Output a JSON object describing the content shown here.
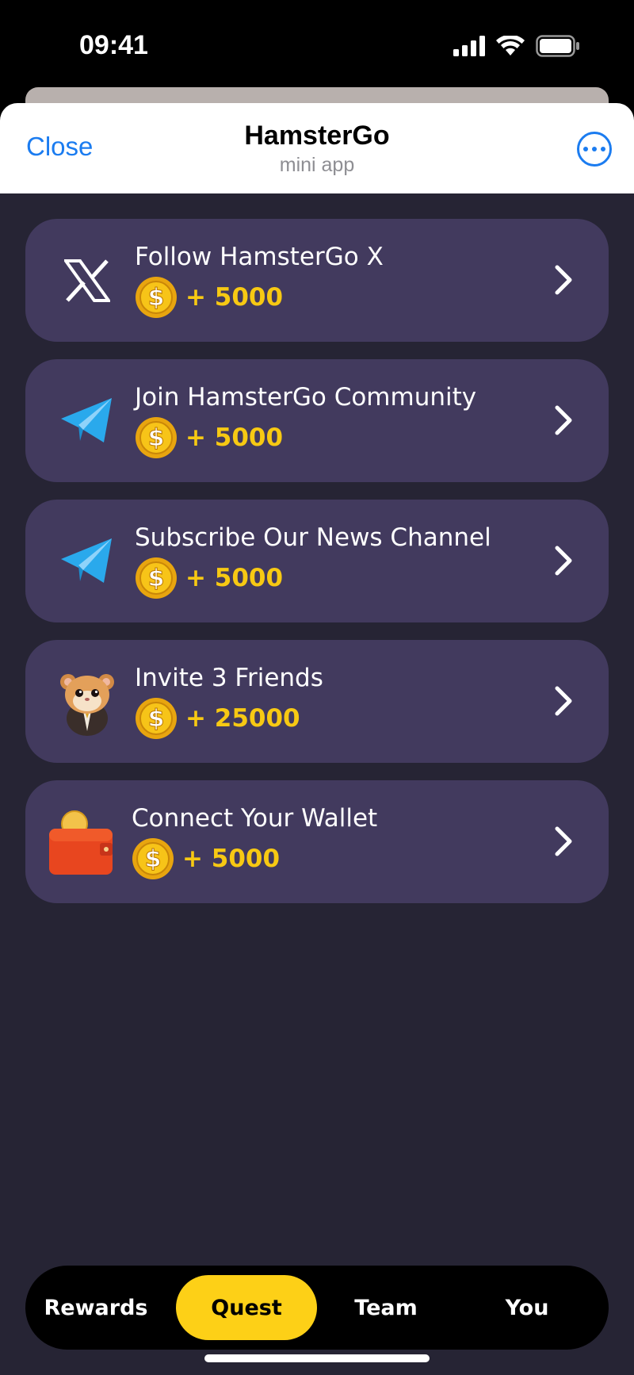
{
  "status": {
    "time": "09:41"
  },
  "header": {
    "close_label": "Close",
    "title": "HamsterGo",
    "subtitle": "mini app"
  },
  "quests": [
    {
      "icon": "x-logo-icon",
      "title": "Follow HamsterGo X",
      "reward": "+ 5000"
    },
    {
      "icon": "telegram-icon",
      "title": "Join HamsterGo Community",
      "reward": "+ 5000"
    },
    {
      "icon": "telegram-icon",
      "title": "Subscribe Our News Channel",
      "reward": "+ 5000"
    },
    {
      "icon": "hamster-icon",
      "title": "Invite 3 Friends",
      "reward": "+ 25000"
    },
    {
      "icon": "wallet-icon",
      "title": "Connect Your Wallet",
      "reward": "+ 5000"
    }
  ],
  "tabs": [
    {
      "label": "Rewards",
      "active": false
    },
    {
      "label": "Quest",
      "active": true
    },
    {
      "label": "Team",
      "active": false
    },
    {
      "label": "You",
      "active": false
    }
  ],
  "colors": {
    "accent": "#1b7cf0",
    "card": "#423a5e",
    "background": "#262434",
    "reward": "#f7c913",
    "tab_active": "#fdd017"
  }
}
